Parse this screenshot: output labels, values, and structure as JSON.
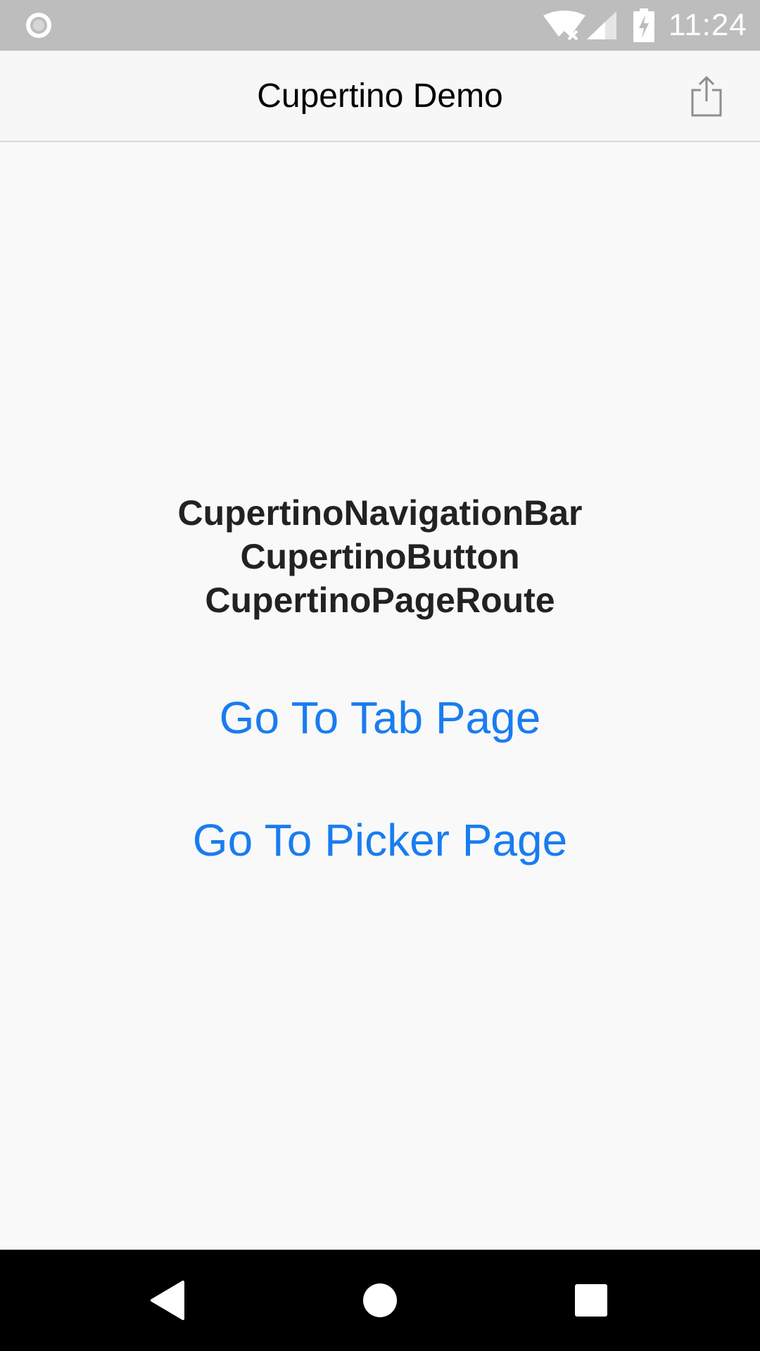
{
  "status_bar": {
    "time": "11:24",
    "icons": [
      "record-icon",
      "wifi-icon",
      "signal-icon",
      "battery-charging-icon"
    ]
  },
  "nav_bar": {
    "title": "Cupertino Demo",
    "trailing_icon": "share-icon"
  },
  "content": {
    "widgets": [
      "CupertinoNavigationBar",
      "CupertinoButton",
      "CupertinoPageRoute"
    ],
    "buttons": {
      "tab_page": "Go To Tab Page",
      "picker_page": "Go To Picker Page"
    }
  },
  "system_nav": {
    "icons": [
      "back-icon",
      "home-icon",
      "recents-icon"
    ]
  },
  "colors": {
    "status_bar_bg": "#bdbdbd",
    "nav_bar_bg": "#f7f7f7",
    "page_bg": "#f9f9f9",
    "link": "#1a7cf0",
    "body_text": "#222222",
    "system_nav_bg": "#000000"
  }
}
